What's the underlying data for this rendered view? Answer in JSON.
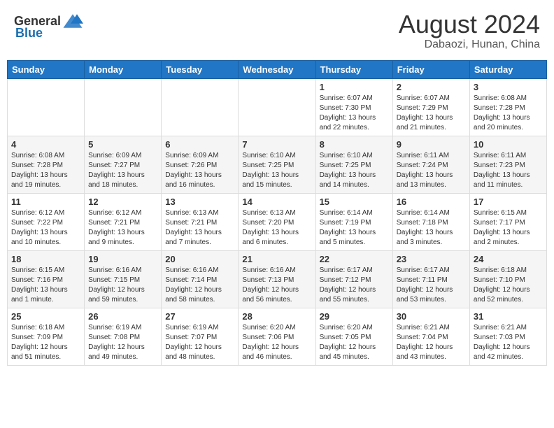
{
  "header": {
    "logo_general": "General",
    "logo_blue": "Blue",
    "month_year": "August 2024",
    "location": "Dabaozi, Hunan, China"
  },
  "days_of_week": [
    "Sunday",
    "Monday",
    "Tuesday",
    "Wednesday",
    "Thursday",
    "Friday",
    "Saturday"
  ],
  "weeks": [
    [
      {
        "day": "",
        "info": ""
      },
      {
        "day": "",
        "info": ""
      },
      {
        "day": "",
        "info": ""
      },
      {
        "day": "",
        "info": ""
      },
      {
        "day": "1",
        "info": "Sunrise: 6:07 AM\nSunset: 7:30 PM\nDaylight: 13 hours\nand 22 minutes."
      },
      {
        "day": "2",
        "info": "Sunrise: 6:07 AM\nSunset: 7:29 PM\nDaylight: 13 hours\nand 21 minutes."
      },
      {
        "day": "3",
        "info": "Sunrise: 6:08 AM\nSunset: 7:28 PM\nDaylight: 13 hours\nand 20 minutes."
      }
    ],
    [
      {
        "day": "4",
        "info": "Sunrise: 6:08 AM\nSunset: 7:28 PM\nDaylight: 13 hours\nand 19 minutes."
      },
      {
        "day": "5",
        "info": "Sunrise: 6:09 AM\nSunset: 7:27 PM\nDaylight: 13 hours\nand 18 minutes."
      },
      {
        "day": "6",
        "info": "Sunrise: 6:09 AM\nSunset: 7:26 PM\nDaylight: 13 hours\nand 16 minutes."
      },
      {
        "day": "7",
        "info": "Sunrise: 6:10 AM\nSunset: 7:25 PM\nDaylight: 13 hours\nand 15 minutes."
      },
      {
        "day": "8",
        "info": "Sunrise: 6:10 AM\nSunset: 7:25 PM\nDaylight: 13 hours\nand 14 minutes."
      },
      {
        "day": "9",
        "info": "Sunrise: 6:11 AM\nSunset: 7:24 PM\nDaylight: 13 hours\nand 13 minutes."
      },
      {
        "day": "10",
        "info": "Sunrise: 6:11 AM\nSunset: 7:23 PM\nDaylight: 13 hours\nand 11 minutes."
      }
    ],
    [
      {
        "day": "11",
        "info": "Sunrise: 6:12 AM\nSunset: 7:22 PM\nDaylight: 13 hours\nand 10 minutes."
      },
      {
        "day": "12",
        "info": "Sunrise: 6:12 AM\nSunset: 7:21 PM\nDaylight: 13 hours\nand 9 minutes."
      },
      {
        "day": "13",
        "info": "Sunrise: 6:13 AM\nSunset: 7:21 PM\nDaylight: 13 hours\nand 7 minutes."
      },
      {
        "day": "14",
        "info": "Sunrise: 6:13 AM\nSunset: 7:20 PM\nDaylight: 13 hours\nand 6 minutes."
      },
      {
        "day": "15",
        "info": "Sunrise: 6:14 AM\nSunset: 7:19 PM\nDaylight: 13 hours\nand 5 minutes."
      },
      {
        "day": "16",
        "info": "Sunrise: 6:14 AM\nSunset: 7:18 PM\nDaylight: 13 hours\nand 3 minutes."
      },
      {
        "day": "17",
        "info": "Sunrise: 6:15 AM\nSunset: 7:17 PM\nDaylight: 13 hours\nand 2 minutes."
      }
    ],
    [
      {
        "day": "18",
        "info": "Sunrise: 6:15 AM\nSunset: 7:16 PM\nDaylight: 13 hours\nand 1 minute."
      },
      {
        "day": "19",
        "info": "Sunrise: 6:16 AM\nSunset: 7:15 PM\nDaylight: 12 hours\nand 59 minutes."
      },
      {
        "day": "20",
        "info": "Sunrise: 6:16 AM\nSunset: 7:14 PM\nDaylight: 12 hours\nand 58 minutes."
      },
      {
        "day": "21",
        "info": "Sunrise: 6:16 AM\nSunset: 7:13 PM\nDaylight: 12 hours\nand 56 minutes."
      },
      {
        "day": "22",
        "info": "Sunrise: 6:17 AM\nSunset: 7:12 PM\nDaylight: 12 hours\nand 55 minutes."
      },
      {
        "day": "23",
        "info": "Sunrise: 6:17 AM\nSunset: 7:11 PM\nDaylight: 12 hours\nand 53 minutes."
      },
      {
        "day": "24",
        "info": "Sunrise: 6:18 AM\nSunset: 7:10 PM\nDaylight: 12 hours\nand 52 minutes."
      }
    ],
    [
      {
        "day": "25",
        "info": "Sunrise: 6:18 AM\nSunset: 7:09 PM\nDaylight: 12 hours\nand 51 minutes."
      },
      {
        "day": "26",
        "info": "Sunrise: 6:19 AM\nSunset: 7:08 PM\nDaylight: 12 hours\nand 49 minutes."
      },
      {
        "day": "27",
        "info": "Sunrise: 6:19 AM\nSunset: 7:07 PM\nDaylight: 12 hours\nand 48 minutes."
      },
      {
        "day": "28",
        "info": "Sunrise: 6:20 AM\nSunset: 7:06 PM\nDaylight: 12 hours\nand 46 minutes."
      },
      {
        "day": "29",
        "info": "Sunrise: 6:20 AM\nSunset: 7:05 PM\nDaylight: 12 hours\nand 45 minutes."
      },
      {
        "day": "30",
        "info": "Sunrise: 6:21 AM\nSunset: 7:04 PM\nDaylight: 12 hours\nand 43 minutes."
      },
      {
        "day": "31",
        "info": "Sunrise: 6:21 AM\nSunset: 7:03 PM\nDaylight: 12 hours\nand 42 minutes."
      }
    ]
  ]
}
